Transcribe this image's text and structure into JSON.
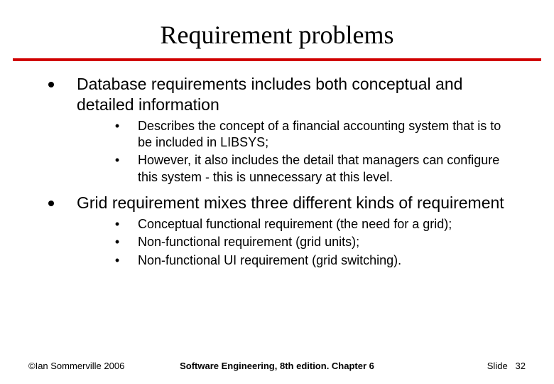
{
  "title": "Requirement problems",
  "points": [
    {
      "text": "Database requirements includes both conceptual and detailed information",
      "sub": [
        "Describes the concept of a financial accounting system that is to be included in LIBSYS;",
        "However, it also includes the detail that managers can configure this system - this is unnecessary at this level."
      ]
    },
    {
      "text": "Grid requirement mixes three different kinds of requirement",
      "sub": [
        "Conceptual functional requirement (the need for a grid);",
        "Non-functional requirement (grid units);",
        "Non-functional UI requirement (grid switching)."
      ]
    }
  ],
  "footer": {
    "left": "©Ian Sommerville 2006",
    "center": "Software Engineering, 8th edition. Chapter 6",
    "right_label": "Slide",
    "right_number": "32"
  },
  "colors": {
    "rule": "#d00000"
  }
}
